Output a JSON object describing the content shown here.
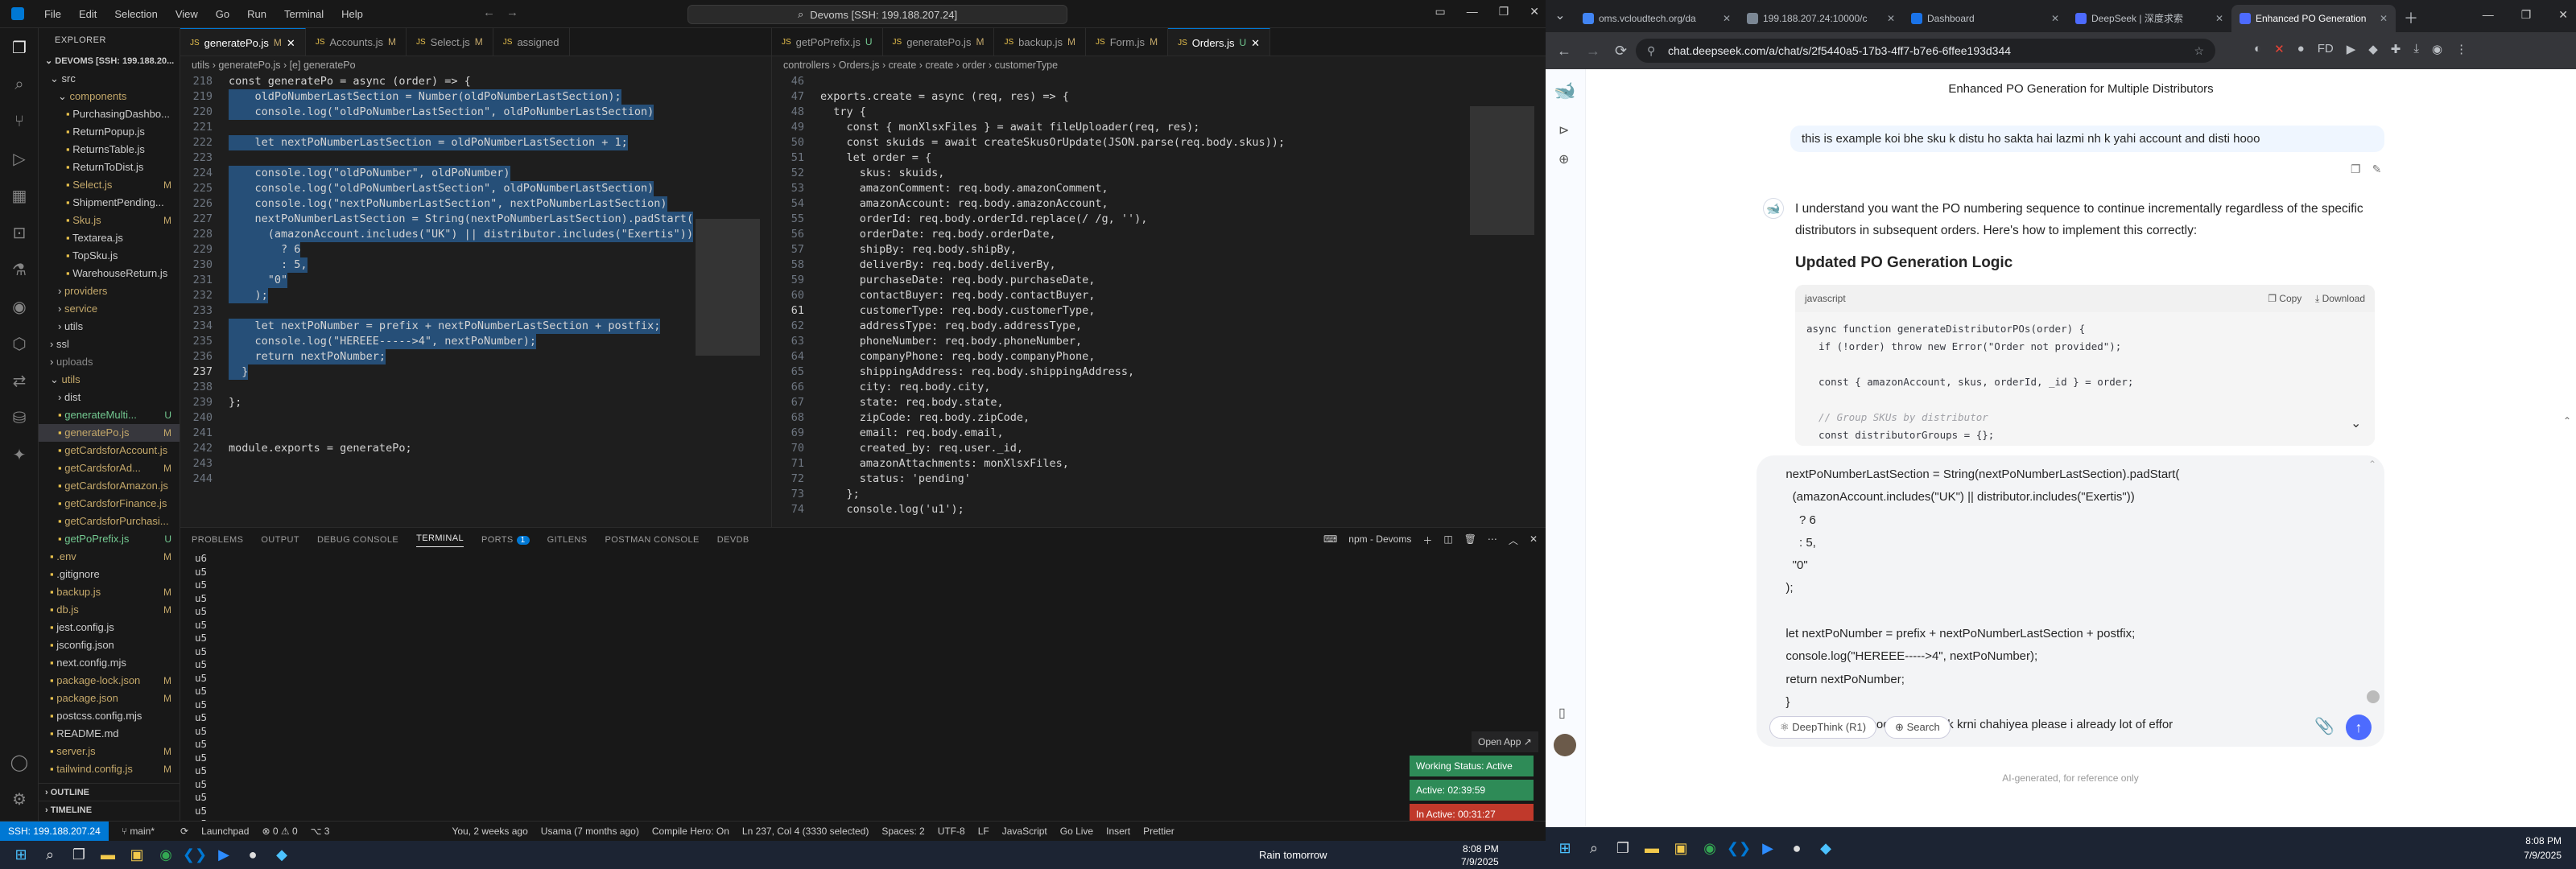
{
  "vscode": {
    "menu": [
      "File",
      "Edit",
      "Selection",
      "View",
      "Go",
      "Run",
      "Terminal",
      "Help"
    ],
    "command_center": "Devoms [SSH: 199.188.207.24]",
    "explorer_header": "EXPLORER",
    "root": "DEVOMS [SSH: 199.188.20...",
    "tree": [
      {
        "label": "src",
        "indent": 1,
        "badge": "",
        "color": "#ccc",
        "kind": "folder-open"
      },
      {
        "label": "components",
        "indent": 2,
        "badge": "",
        "color": "#c4a86a",
        "kind": "folder-open"
      },
      {
        "label": "PurchasingDashbo...",
        "indent": 3,
        "badge": "",
        "color": "#ccc",
        "kind": "file"
      },
      {
        "label": "ReturnPopup.js",
        "indent": 3,
        "badge": "",
        "color": "#ccc",
        "kind": "file"
      },
      {
        "label": "ReturnsTable.js",
        "indent": 3,
        "badge": "",
        "color": "#ccc",
        "kind": "file"
      },
      {
        "label": "ReturnToDist.js",
        "indent": 3,
        "badge": "",
        "color": "#ccc",
        "kind": "file"
      },
      {
        "label": "Select.js",
        "indent": 3,
        "badge": "M",
        "color": "#c4a86a",
        "kind": "file"
      },
      {
        "label": "ShipmentPending...",
        "indent": 3,
        "badge": "",
        "color": "#ccc",
        "kind": "file"
      },
      {
        "label": "Sku.js",
        "indent": 3,
        "badge": "M",
        "color": "#c4a86a",
        "kind": "file"
      },
      {
        "label": "Textarea.js",
        "indent": 3,
        "badge": "",
        "color": "#ccc",
        "kind": "file"
      },
      {
        "label": "TopSku.js",
        "indent": 3,
        "badge": "",
        "color": "#ccc",
        "kind": "file"
      },
      {
        "label": "WarehouseReturn.js",
        "indent": 3,
        "badge": "",
        "color": "#ccc",
        "kind": "file"
      },
      {
        "label": "providers",
        "indent": 2,
        "badge": "",
        "color": "#c4a86a",
        "kind": "folder"
      },
      {
        "label": "service",
        "indent": 2,
        "badge": "",
        "color": "#c4a86a",
        "kind": "folder"
      },
      {
        "label": "utils",
        "indent": 2,
        "badge": "",
        "color": "#ccc",
        "kind": "folder"
      },
      {
        "label": "ssl",
        "indent": 1,
        "badge": "",
        "color": "#ccc",
        "kind": "folder"
      },
      {
        "label": "uploads",
        "indent": 1,
        "badge": "",
        "color": "#888",
        "kind": "folder"
      },
      {
        "label": "utils",
        "indent": 1,
        "badge": "",
        "color": "#c4a86a",
        "kind": "folder-open"
      },
      {
        "label": "dist",
        "indent": 2,
        "badge": "",
        "color": "#ccc",
        "kind": "folder"
      },
      {
        "label": "generateMulti...",
        "indent": 2,
        "badge": "U",
        "color": "#73c991",
        "kind": "file"
      },
      {
        "label": "generatePo.js",
        "indent": 2,
        "badge": "M",
        "color": "#c4a86a",
        "kind": "file",
        "selected": true
      },
      {
        "label": "getCardsforAccount.js",
        "indent": 2,
        "badge": "",
        "color": "#c4a86a",
        "kind": "file"
      },
      {
        "label": "getCardsforAd...",
        "indent": 2,
        "badge": "M",
        "color": "#c4a86a",
        "kind": "file"
      },
      {
        "label": "getCardsforAmazon.js",
        "indent": 2,
        "badge": "",
        "color": "#c4a86a",
        "kind": "file"
      },
      {
        "label": "getCardsforFinance.js",
        "indent": 2,
        "badge": "",
        "color": "#c4a86a",
        "kind": "file"
      },
      {
        "label": "getCardsforPurchasi...",
        "indent": 2,
        "badge": "",
        "color": "#c4a86a",
        "kind": "file"
      },
      {
        "label": "getPoPrefix.js",
        "indent": 2,
        "badge": "U",
        "color": "#73c991",
        "kind": "file"
      },
      {
        "label": ".env",
        "indent": 1,
        "badge": "M",
        "color": "#c4a86a",
        "kind": "file"
      },
      {
        "label": ".gitignore",
        "indent": 1,
        "badge": "",
        "color": "#ccc",
        "kind": "file"
      },
      {
        "label": "backup.js",
        "indent": 1,
        "badge": "M",
        "color": "#c4a86a",
        "kind": "file"
      },
      {
        "label": "db.js",
        "indent": 1,
        "badge": "M",
        "color": "#c4a86a",
        "kind": "file"
      },
      {
        "label": "jest.config.js",
        "indent": 1,
        "badge": "",
        "color": "#ccc",
        "kind": "file"
      },
      {
        "label": "jsconfig.json",
        "indent": 1,
        "badge": "",
        "color": "#ccc",
        "kind": "file"
      },
      {
        "label": "next.config.mjs",
        "indent": 1,
        "badge": "",
        "color": "#ccc",
        "kind": "file"
      },
      {
        "label": "package-lock.json",
        "indent": 1,
        "badge": "M",
        "color": "#c4a86a",
        "kind": "file"
      },
      {
        "label": "package.json",
        "indent": 1,
        "badge": "M",
        "color": "#c4a86a",
        "kind": "file"
      },
      {
        "label": "postcss.config.mjs",
        "indent": 1,
        "badge": "",
        "color": "#ccc",
        "kind": "file"
      },
      {
        "label": "README.md",
        "indent": 1,
        "badge": "",
        "color": "#ccc",
        "kind": "file"
      },
      {
        "label": "server.js",
        "indent": 1,
        "badge": "M",
        "color": "#c4a86a",
        "kind": "file"
      },
      {
        "label": "tailwind.config.js",
        "indent": 1,
        "badge": "M",
        "color": "#c4a86a",
        "kind": "file"
      }
    ],
    "outline": "OUTLINE",
    "timeline": "TIMELINE",
    "editor1": {
      "tabs": [
        {
          "label": "generatePo.js",
          "mark": "M",
          "active": true
        },
        {
          "label": "Accounts.js",
          "mark": "M"
        },
        {
          "label": "Select.js",
          "mark": "M"
        },
        {
          "label": "assigned",
          "mark": ""
        }
      ],
      "breadcrumbs": "utils  ›  generatePo.js  ›  [e] generatePo",
      "lines": [
        {
          "n": "219",
          "t": "    oldPoNumberLastSection = Number(oldPoNumberLastSection);",
          "hl": true
        },
        {
          "n": "220",
          "t": "    console.log(\"oldPoNumberLastSection\", oldPoNumberLastSection)",
          "hl": true
        },
        {
          "n": "221",
          "t": "",
          "hl": true
        },
        {
          "n": "222",
          "t": "    let nextPoNumberLastSection = oldPoNumberLastSection + 1;",
          "hl": true
        },
        {
          "n": "223",
          "t": "",
          "hl": true
        },
        {
          "n": "224",
          "t": "    console.log(\"oldPoNumber\", oldPoNumber)",
          "hl": true
        },
        {
          "n": "225",
          "t": "    console.log(\"oldPoNumberLastSection\", oldPoNumberLastSection)",
          "hl": true
        },
        {
          "n": "226",
          "t": "    console.log(\"nextPoNumberLastSection\", nextPoNumberLastSection)",
          "hl": true
        },
        {
          "n": "227",
          "t": "    nextPoNumberLastSection = String(nextPoNumberLastSection).padStart(",
          "hl": true
        },
        {
          "n": "228",
          "t": "      (amazonAccount.includes(\"UK\") || distributor.includes(\"Exertis\"))",
          "hl": true
        },
        {
          "n": "229",
          "t": "        ? 6",
          "hl": true
        },
        {
          "n": "230",
          "t": "        : 5,",
          "hl": true
        },
        {
          "n": "231",
          "t": "      \"0\"",
          "hl": true
        },
        {
          "n": "232",
          "t": "    );",
          "hl": true
        },
        {
          "n": "233",
          "t": "",
          "hl": true
        },
        {
          "n": "234",
          "t": "    let nextPoNumber = prefix + nextPoNumberLastSection + postfix;",
          "hl": true
        },
        {
          "n": "235",
          "t": "    console.log(\"HEREEE----->4\", nextPoNumber);",
          "hl": true
        },
        {
          "n": "236",
          "t": "    return nextPoNumber;",
          "hl": true
        },
        {
          "n": "237",
          "t": "  }",
          "hl": true,
          "cur": true
        },
        {
          "n": "238",
          "t": ""
        },
        {
          "n": "239",
          "t": "};"
        },
        {
          "n": "240",
          "t": ""
        },
        {
          "n": "241",
          "t": ""
        },
        {
          "n": "242",
          "t": "module.exports = generatePo;"
        },
        {
          "n": "243",
          "t": ""
        },
        {
          "n": "244",
          "t": ""
        }
      ],
      "first_line": "const generatePo = async (order) => {"
    },
    "editor2": {
      "tabs": [
        {
          "label": "getPoPrefix.js",
          "mark": "U"
        },
        {
          "label": "generatePo.js",
          "mark": "M"
        },
        {
          "label": "backup.js",
          "mark": "M"
        },
        {
          "label": "Form.js",
          "mark": "M"
        },
        {
          "label": "Orders.js",
          "mark": "U",
          "active": true
        }
      ],
      "breadcrumbs": "controllers  ›  Orders.js  ›  create  ›  create  ›  order  ›  customerType",
      "lines": [
        {
          "n": "46",
          "t": ""
        },
        {
          "n": "47",
          "t": "exports.create = async (req, res) => {"
        },
        {
          "n": "48",
          "t": "  try {"
        },
        {
          "n": "49",
          "t": "    const { monXlsxFiles } = await fileUploader(req, res);"
        },
        {
          "n": "50",
          "t": "    const skuids = await createSkusOrUpdate(JSON.parse(req.body.skus));"
        },
        {
          "n": "51",
          "t": "    let order = {"
        },
        {
          "n": "52",
          "t": "      skus: skuids,"
        },
        {
          "n": "53",
          "t": "      amazonComment: req.body.amazonComment,"
        },
        {
          "n": "54",
          "t": "      amazonAccount: req.body.amazonAccount,"
        },
        {
          "n": "55",
          "t": "      orderId: req.body.orderId.replace(/ /g, ''),"
        },
        {
          "n": "56",
          "t": "      orderDate: req.body.orderDate,"
        },
        {
          "n": "57",
          "t": "      shipBy: req.body.shipBy,"
        },
        {
          "n": "58",
          "t": "      deliverBy: req.body.deliverBy,"
        },
        {
          "n": "59",
          "t": "      purchaseDate: req.body.purchaseDate,"
        },
        {
          "n": "60",
          "t": "      contactBuyer: req.body.contactBuyer,"
        },
        {
          "n": "61",
          "t": "      customerType: req.body.customerType,",
          "cur": true
        },
        {
          "n": "62",
          "t": "      addressType: req.body.addressType,"
        },
        {
          "n": "63",
          "t": "      phoneNumber: req.body.phoneNumber,"
        },
        {
          "n": "64",
          "t": "      companyPhone: req.body.companyPhone,"
        },
        {
          "n": "65",
          "t": "      shippingAddress: req.body.shippingAddress,"
        },
        {
          "n": "66",
          "t": "      city: req.body.city,"
        },
        {
          "n": "67",
          "t": "      state: req.body.state,"
        },
        {
          "n": "68",
          "t": "      zipCode: req.body.zipCode,"
        },
        {
          "n": "69",
          "t": "      email: req.body.email,"
        },
        {
          "n": "70",
          "t": "      created_by: req.user._id,"
        },
        {
          "n": "71",
          "t": "      amazonAttachments: monXlsxFiles,"
        },
        {
          "n": "72",
          "t": "      status: 'pending'"
        },
        {
          "n": "73",
          "t": "    };"
        },
        {
          "n": "74",
          "t": "    console.log('u1');"
        }
      ]
    },
    "panel_tabs": [
      "PROBLEMS",
      "OUTPUT",
      "DEBUG CONSOLE",
      "TERMINAL",
      "PORTS",
      "GITLENS",
      "POSTMAN CONSOLE",
      "DEVDB"
    ],
    "ports_count": "1",
    "terminal_name": "npm - Devoms",
    "terminal_lines": [
      "u6",
      "u5",
      "u5",
      "u5",
      "u5",
      "u5",
      "u5",
      "u5",
      "u5",
      "u5",
      "u5",
      "u5",
      "u5",
      "u5",
      "u5",
      "u5",
      "u5",
      "u5",
      "u5",
      "u5",
      "u5",
      "u5"
    ],
    "open_app": "Open App ↗",
    "working_status": "Working Status: Active",
    "active_time": "Active: 02:39:59",
    "inactive_time": "In Active: 00:31:27",
    "status": {
      "remote": "SSH: 199.188.207.24",
      "branch": "main*",
      "sync": "⟳",
      "errors": "⊗ 0 ⚠ 0",
      "launch": "Launchpad",
      "ports": "3",
      "blame": "You, 2 weeks ago",
      "author": "Usama (7 months ago)",
      "compile": "Compile Hero: On",
      "position": "Ln 237, Col 4 (3330 selected)",
      "spaces": "Spaces: 2",
      "encoding": "UTF-8",
      "eol": "LF",
      "lang": "JavaScript",
      "golive": "Go Live",
      "insert": "Insert",
      "prettier": "Prettier"
    },
    "taskbar": {
      "weather": "Rain tomorrow",
      "time": "8:08 PM",
      "date": "7/9/2025"
    }
  },
  "chrome": {
    "tabs": [
      {
        "label": "oms.vcloudtech.org/da",
        "color": "#4285f4"
      },
      {
        "label": "199.188.207.24:10000/c",
        "color": "#7b8794"
      },
      {
        "label": "Dashboard",
        "color": "#1a73e8"
      },
      {
        "label": "DeepSeek | 深度求索",
        "color": "#4d6bfe"
      },
      {
        "label": "Enhanced PO Generation",
        "color": "#4d6bfe",
        "active": true
      }
    ],
    "url": "chat.deepseek.com/a/chat/s/2f5440a5-17b3-4ff7-b7e6-6ffee193d344",
    "chat_title": "Enhanced PO Generation for Multiple Distributors",
    "user_msg": "this is example koi bhe sku k distu ho sakta hai lazmi nh k yahi account and disti hooo",
    "ai_intro": "I understand you want the PO numbering sequence to continue incrementally regardless of the specific distributors in subsequent orders. Here's how to implement this correctly:",
    "ai_heading": "Updated PO Generation Logic",
    "code_lang": "javascript",
    "copy": "Copy",
    "download": "Download",
    "code_lines": [
      "async function generateDistributorPOs(order) {",
      "  if (!order) throw new Error(\"Order not provided\");",
      "",
      "  const { amazonAccount, skus, orderId, _id } = order;",
      "",
      "  // Group SKUs by distributor",
      "  const distributorGroups = {};"
    ],
    "composer_lines": [
      "  nextPoNumberLastSection = String(nextPoNumberLastSection).padStart(",
      "    (amazonAccount.includes(\"UK\") || distributor.includes(\"Exertis\"))",
      "      ? 6",
      "      : 5,",
      "    \"0\"",
      "  );",
      "",
      "  let nextPoNumber = prefix + nextPoNumberLastSection + postfix;",
      "  console.log(\"HEREEE----->4\", nextPoNumber);",
      "  return nextPoNumber;",
      "  }",
      "according to this code logic work krni chahiyea please i already lot of effor"
    ],
    "deepthink": "DeepThink (R1)",
    "search": "Search",
    "footer": "AI-generated, for reference only",
    "clock_time": "8:08 PM",
    "clock_date": "7/9/2025"
  }
}
